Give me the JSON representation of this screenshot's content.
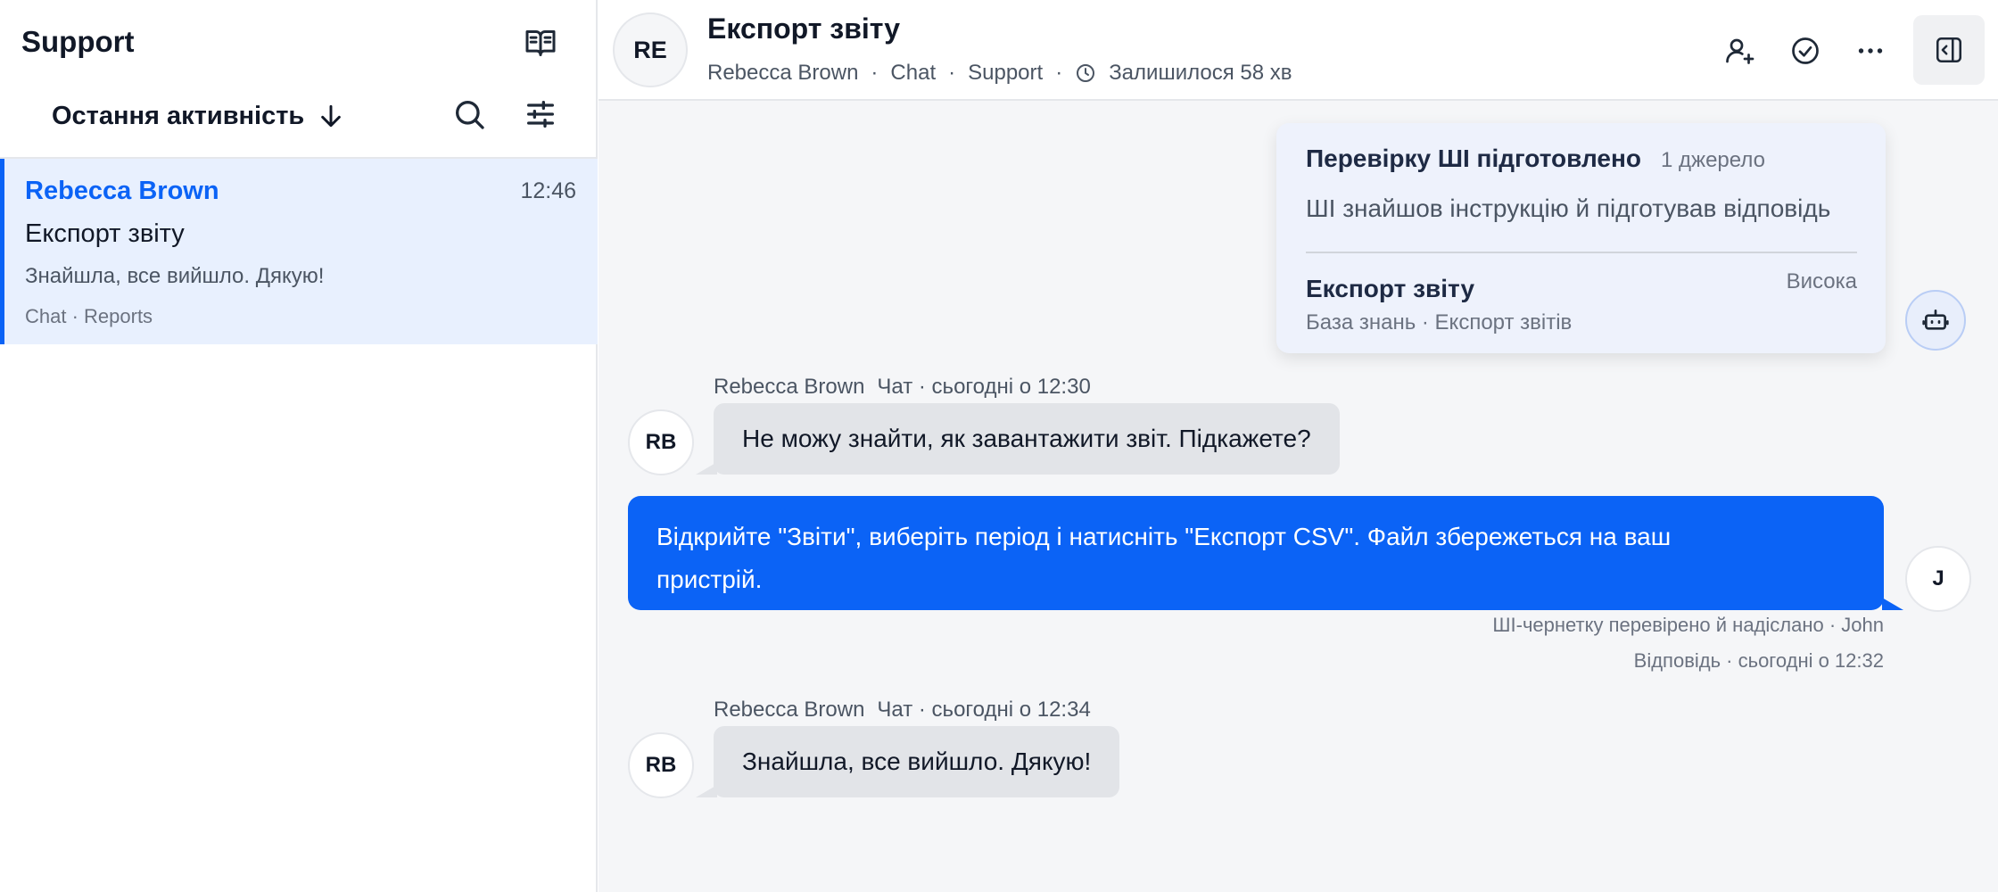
{
  "sidebar": {
    "title": "Support",
    "sort_label": "Остання активність",
    "conversation": {
      "name": "Rebecca Brown",
      "time": "12:46",
      "subject": "Експорт звіту",
      "preview": "Знайшла, все вийшло. Дякую!",
      "meta": "Chat · Reports"
    }
  },
  "header": {
    "avatar_initials": "RE",
    "title": "Експорт звіту",
    "customer": "Rebecca Brown",
    "channel": "Chat",
    "team": "Support",
    "sla": "Залишилося 58 хв"
  },
  "ai_card": {
    "title": "Перевірку ШІ підготовлено",
    "sources": "1 джерело",
    "summary": "ШІ знайшов інструкцію й підготував відповідь",
    "article_title": "Експорт звіту",
    "priority": "Висока",
    "article_meta": "База знань · Експорт звітів"
  },
  "messages": [
    {
      "author": "Rebecca Brown",
      "meta": "Чат · сьогодні о 12:30",
      "initials": "RB",
      "text": "Не можу знайти, як завантажити звіт. Підкажете?"
    },
    {
      "initials": "J",
      "text": "Відкрийте \"Звіти\", виберіть період і натисніть \"Експорт CSV\". Файл збережеться на ваш пристрій.",
      "note": "ШІ-чернетку перевірено й надіслано · John",
      "meta": "Відповідь · сьогодні о 12:32"
    },
    {
      "author": "Rebecca Brown",
      "meta": "Чат · сьогодні о 12:34",
      "initials": "RB",
      "text": "Знайшла, все вийшло. Дякую!"
    }
  ],
  "colors": {
    "accent": "#0b63f6",
    "selected_bg": "#e8f0fe",
    "incoming_bubble": "#e2e4e8",
    "ai_card_bg": "#eef2fc"
  },
  "icons": [
    "book-icon",
    "arrow-down-icon",
    "search-icon",
    "filter-icon",
    "clock-icon",
    "assign-user-icon",
    "resolve-check-icon",
    "more-icon",
    "side-panel-icon",
    "bot-icon"
  ]
}
